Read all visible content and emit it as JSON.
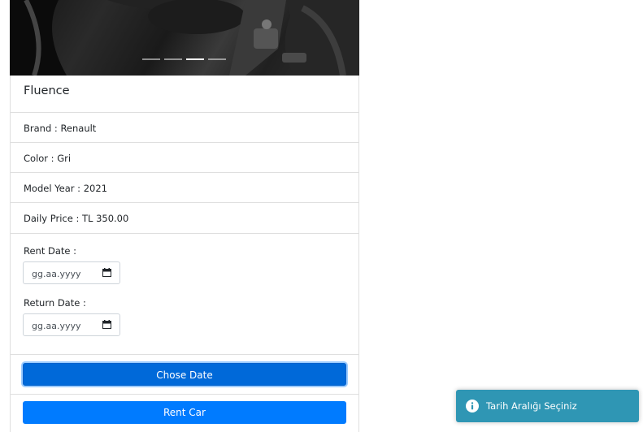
{
  "car": {
    "name": "Fluence",
    "brand": "Brand : Renault",
    "color": "Color : Gri",
    "model_year": "Model Year : 2021",
    "daily_price": "Daily Price : TL 350.00"
  },
  "carousel": {
    "indicator_count": 4,
    "active_index": 2
  },
  "form": {
    "rent_date_label": "Rent Date :",
    "rent_date_placeholder": "gg.aa.yyyy",
    "return_date_label": "Return Date :",
    "return_date_placeholder": "gg.aa.yyyy"
  },
  "buttons": {
    "chose_date": "Chose Date",
    "rent_car": "Rent Car"
  },
  "toast": {
    "message": "Tarih Aralığı Seçiniz",
    "icon": "info-icon"
  },
  "colors": {
    "primary": "#007bff",
    "primary_active": "#0069d9",
    "toast_info": "#2f96b4"
  }
}
